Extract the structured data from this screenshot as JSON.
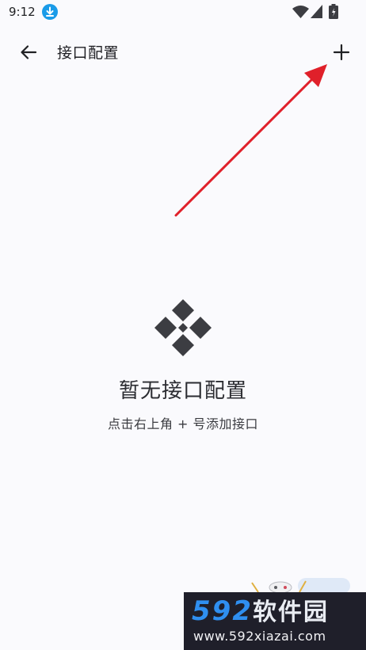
{
  "status_bar": {
    "time": "9:12",
    "icons": [
      "download-icon",
      "wifi-icon",
      "signal-icon",
      "battery-icon"
    ]
  },
  "app_bar": {
    "title": "接口配置",
    "back_icon": "arrow-left-icon",
    "add_icon": "plus-icon"
  },
  "empty_state": {
    "icon": "diamond-grid-icon",
    "title": "暂无接口配置",
    "hint": "点击右上角 + 号添加接口"
  },
  "annotation": {
    "arrow_color": "#e0202a"
  },
  "watermark": {
    "logo_digits": "592",
    "logo_text": "软件园",
    "url": "www.592xiazai.com"
  },
  "colors": {
    "background": "#fafafd",
    "text_primary": "#1f1f24",
    "icon_dark": "#3c3d42",
    "status_accent": "#1a9be8"
  }
}
